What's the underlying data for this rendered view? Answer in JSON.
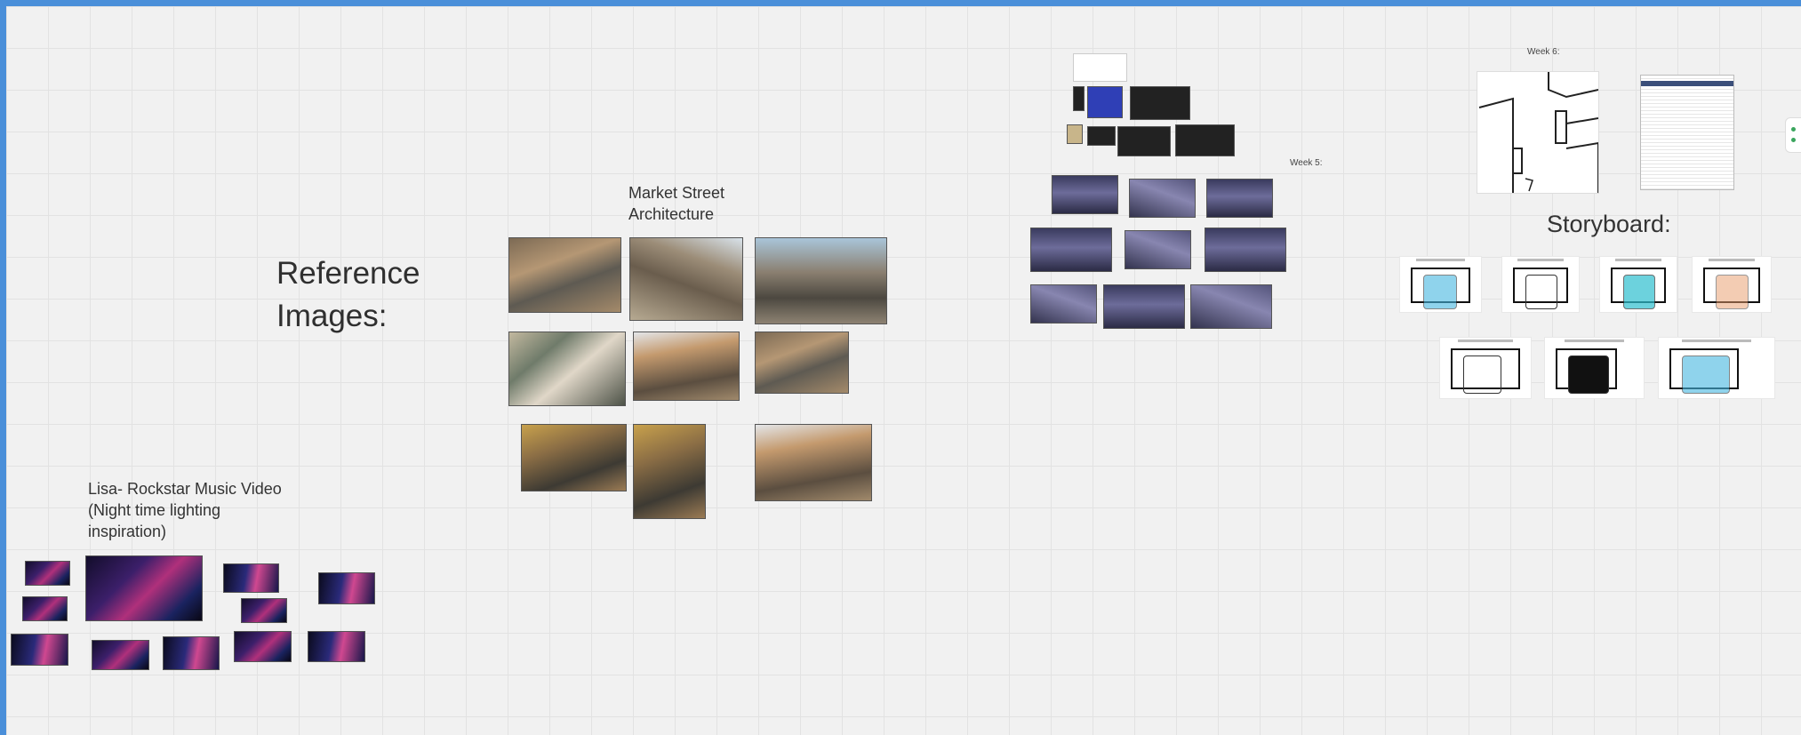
{
  "board": {
    "reference_title": "Reference\nImages:",
    "market_title": "Market Street\nArchitecture",
    "lisa_title": "Lisa- Rockstar Music Video\n(Night time lighting\ninspiration)",
    "week5_label": "Week 5:",
    "week6_label": "Week 6:",
    "storyboard_title": "Storyboard:"
  },
  "colors": {
    "accent_border": "#4a8fd9",
    "canvas_bg": "#f1f1f1"
  }
}
